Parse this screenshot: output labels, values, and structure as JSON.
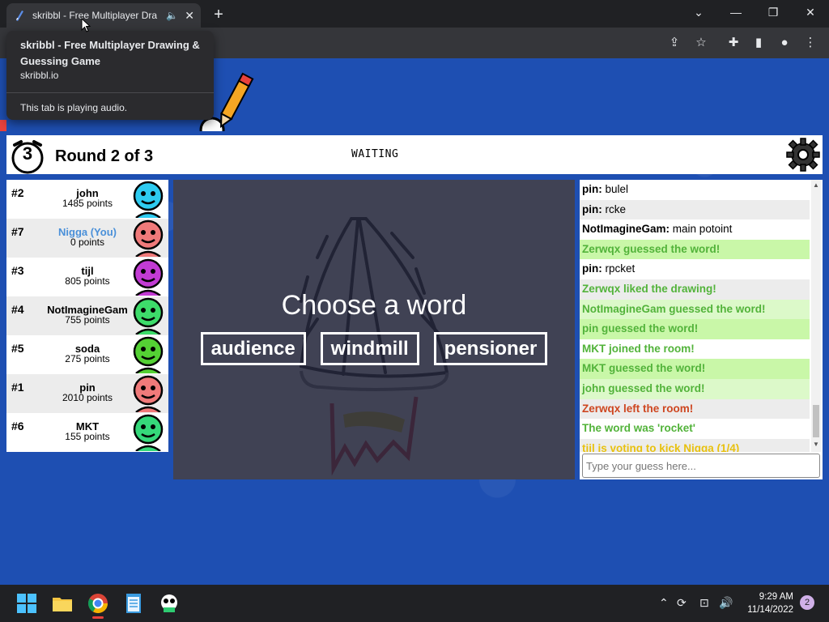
{
  "browser": {
    "tab_title": "skribbl - Free Multiplayer Dra",
    "tooltip": {
      "title": "skribbl - Free Multiplayer Drawing & Guessing Game",
      "domain": "skribbl.io",
      "audio_note": "This tab is playing audio."
    }
  },
  "header": {
    "timer": "3",
    "round": "Round 2 of 3",
    "status": "WAITING"
  },
  "players": [
    {
      "rank": "#2",
      "name": "john",
      "points": "1485 points",
      "color": "#2ecbf0",
      "you": false
    },
    {
      "rank": "#7",
      "name": "Nigga (You)",
      "points": "0 points",
      "color": "#f07a7a",
      "you": true
    },
    {
      "rank": "#3",
      "name": "tijl",
      "points": "805 points",
      "color": "#c23bd4",
      "you": false
    },
    {
      "rank": "#4",
      "name": "NotImagineGam",
      "points": "755 points",
      "color": "#3ddc6a",
      "you": false
    },
    {
      "rank": "#5",
      "name": "soda",
      "points": "275 points",
      "color": "#54d134",
      "you": false
    },
    {
      "rank": "#1",
      "name": "pin",
      "points": "2010 points",
      "color": "#f07a7a",
      "you": false
    },
    {
      "rank": "#6",
      "name": "MKT",
      "points": "155 points",
      "color": "#35d87a",
      "you": false
    }
  ],
  "canvas": {
    "prompt": "Choose a word",
    "words": [
      "audience",
      "windmill",
      "pensioner"
    ]
  },
  "chat": {
    "messages": [
      {
        "author": "pin",
        "text": "bulel",
        "style": "normal"
      },
      {
        "author": "pin",
        "text": "rcke",
        "style": "alt"
      },
      {
        "author": "NotImagineGam",
        "text": "main potoint",
        "style": "normal"
      },
      {
        "author": "",
        "text": "Zerwqx guessed the word!",
        "style": "greenbg"
      },
      {
        "author": "pin",
        "text": "rpcket",
        "style": "normal"
      },
      {
        "author": "",
        "text": "Zerwqx liked the drawing!",
        "style": "greenalt"
      },
      {
        "author": "",
        "text": "NotImagineGam guessed the word!",
        "style": "greenbg2"
      },
      {
        "author": "",
        "text": "pin guessed the word!",
        "style": "greenbg"
      },
      {
        "author": "",
        "text": "MKT joined the room!",
        "style": "green"
      },
      {
        "author": "",
        "text": "MKT guessed the word!",
        "style": "greenbg"
      },
      {
        "author": "",
        "text": "john guessed the word!",
        "style": "greenbg2"
      },
      {
        "author": "",
        "text": "Zerwqx left the room!",
        "style": "redalt"
      },
      {
        "author": "",
        "text": "The word was 'rocket'",
        "style": "green"
      },
      {
        "author": "",
        "text": "tijl is voting to kick Nigga (1/4)",
        "style": "yellowalt"
      }
    ],
    "input_placeholder": "Type your guess here..."
  },
  "taskbar": {
    "time": "9:29 AM",
    "date": "11/14/2022",
    "notifications": "2"
  }
}
